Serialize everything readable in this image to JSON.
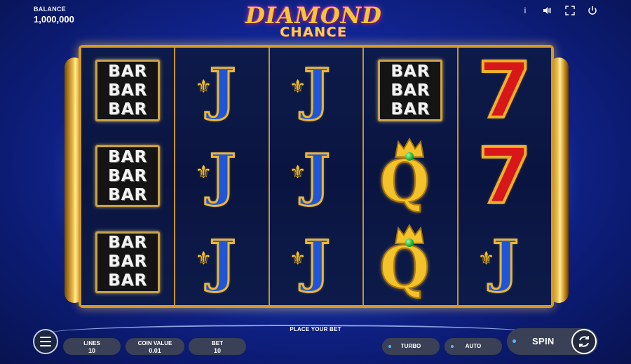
{
  "balance": {
    "label": "BALANCE",
    "value": "1,000,000"
  },
  "logo": {
    "line1": "DIAMOND",
    "line2": "CHANCE"
  },
  "top_icons": [
    "info-icon",
    "sound-icon",
    "fullscreen-icon",
    "power-icon"
  ],
  "reels": [
    [
      "bar",
      "bar",
      "bar"
    ],
    [
      "jack",
      "jack",
      "jack"
    ],
    [
      "jack",
      "jack",
      "jack"
    ],
    [
      "bar",
      "queen",
      "queen"
    ],
    [
      "seven",
      "seven",
      "jack"
    ]
  ],
  "symbols": {
    "bar_text": "BAR",
    "jack_text": "J",
    "queen_text": "Q",
    "seven_text": "7"
  },
  "bottom": {
    "status": "PLACE YOUR BET",
    "lines": {
      "label": "LINES",
      "value": "10"
    },
    "coin_value": {
      "label": "COIN VALUE",
      "value": "0.01"
    },
    "bet": {
      "label": "BET",
      "value": "10"
    },
    "turbo": "TURBO",
    "auto": "AUTO",
    "spin": "SPIN"
  },
  "colors": {
    "accent": "#5bb3ff",
    "gold": "#d69a22",
    "background": "#13279a"
  }
}
